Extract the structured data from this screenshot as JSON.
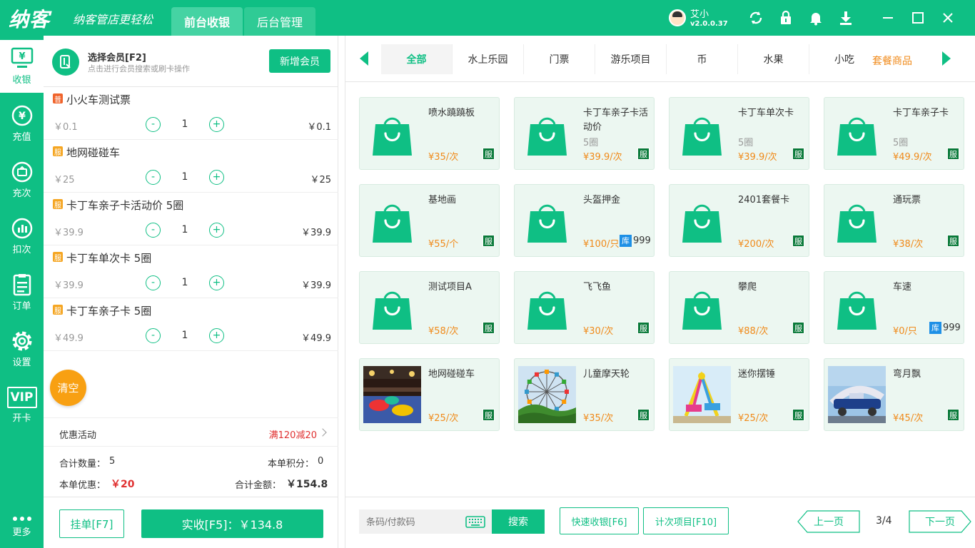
{
  "header": {
    "logo": "纳客",
    "slogan": "纳客管店更轻松",
    "tabs": [
      {
        "label": "前台收银"
      },
      {
        "label": "后台管理"
      }
    ],
    "user": {
      "name": "艾小",
      "version": "v2.0.0.37"
    }
  },
  "sidebar": {
    "items": [
      {
        "label": "收银",
        "icon": "cashier-icon"
      },
      {
        "label": "充值",
        "icon": "recharge-icon"
      },
      {
        "label": "充次",
        "icon": "recharge-times-icon"
      },
      {
        "label": "扣次",
        "icon": "deduct-icon"
      },
      {
        "label": "订单",
        "icon": "order-icon"
      },
      {
        "label": "设置",
        "icon": "settings-icon"
      },
      {
        "label": "开卡",
        "icon": "vip-card-icon"
      },
      {
        "label": "更多",
        "icon": "more-icon"
      }
    ],
    "vip_text": "VIP"
  },
  "member": {
    "title": "选择会员[F2]",
    "subtitle": "点击进行会员搜索或刷卡操作",
    "new_button": "新增会员"
  },
  "cart": {
    "items": [
      {
        "badge": "普",
        "name": "小火车测试票",
        "price": "￥0.1",
        "qty": "1",
        "total": "￥0.1"
      },
      {
        "badge": "服",
        "name": "地网碰碰车",
        "price": "￥25",
        "qty": "1",
        "total": "￥25"
      },
      {
        "badge": "服",
        "name": "卡丁车亲子卡活动价 5圈",
        "price": "￥39.9",
        "qty": "1",
        "total": "￥39.9"
      },
      {
        "badge": "服",
        "name": "卡丁车单次卡 5圈",
        "price": "￥39.9",
        "qty": "1",
        "total": "￥39.9"
      },
      {
        "badge": "服",
        "name": "卡丁车亲子卡 5圈",
        "price": "￥49.9",
        "qty": "1",
        "total": "￥49.9"
      }
    ],
    "minus": "-",
    "plus": "+",
    "clear_button": "清空"
  },
  "promotion": {
    "label": "优惠活动",
    "value": "满120减20"
  },
  "summary": {
    "count_label": "合计数量：",
    "count_value": "5",
    "points_label": "本单积分：",
    "points_value": "0",
    "discount_label": "本单优惠：",
    "discount_value": "￥20",
    "amount_label": "合计金额：",
    "amount_value": "￥154.8"
  },
  "actions": {
    "hang_button": "挂单[F7]",
    "pay_button": "实收[F5]：￥134.8"
  },
  "categories": {
    "items": [
      "全部",
      "水上乐园",
      "门票",
      "游乐项目",
      "币",
      "水果",
      "小吃"
    ],
    "extra": "套餐商品"
  },
  "products": [
    {
      "name": "喷水蹺蹺板",
      "sub": "",
      "price": "¥35/次",
      "tag": "服",
      "stock": "",
      "img": "bag"
    },
    {
      "name": "卡丁车亲子卡活动价",
      "sub": "5圈",
      "price": "¥39.9/次",
      "tag": "服",
      "stock": "",
      "img": "bag"
    },
    {
      "name": "卡丁车单次卡",
      "sub": "5圈",
      "price": "¥39.9/次",
      "tag": "服",
      "stock": "",
      "img": "bag"
    },
    {
      "name": "卡丁车亲子卡",
      "sub": "5圈",
      "price": "¥49.9/次",
      "tag": "服",
      "stock": "",
      "img": "bag"
    },
    {
      "name": "基地画",
      "sub": "",
      "price": "¥55/个",
      "tag": "服",
      "stock": "",
      "img": "bag"
    },
    {
      "name": "头盔押金",
      "sub": "",
      "price": "¥100/只",
      "tag": "",
      "stock": "999",
      "img": "bag"
    },
    {
      "name": "2401套餐卡",
      "sub": "",
      "price": "¥200/次",
      "tag": "服",
      "stock": "",
      "img": "bag"
    },
    {
      "name": "通玩票",
      "sub": "",
      "price": "¥38/次",
      "tag": "服",
      "stock": "",
      "img": "bag"
    },
    {
      "name": "测试项目A",
      "sub": "",
      "price": "¥58/次",
      "tag": "服",
      "stock": "",
      "img": "bag"
    },
    {
      "name": "飞飞鱼",
      "sub": "",
      "price": "¥30/次",
      "tag": "服",
      "stock": "",
      "img": "bag"
    },
    {
      "name": "攀爬",
      "sub": "",
      "price": "¥88/次",
      "tag": "服",
      "stock": "",
      "img": "bag"
    },
    {
      "name": "车速",
      "sub": "",
      "price": "¥0/只",
      "tag": "",
      "stock": "999",
      "img": "bag"
    },
    {
      "name": "地网碰碰车",
      "sub": "",
      "price": "¥25/次",
      "tag": "服",
      "stock": "",
      "img": "bumper"
    },
    {
      "name": "儿童摩天轮",
      "sub": "",
      "price": "¥35/次",
      "tag": "服",
      "stock": "",
      "img": "ferris"
    },
    {
      "name": "迷你摆锤",
      "sub": "",
      "price": "¥25/次",
      "tag": "服",
      "stock": "",
      "img": "pendulum"
    },
    {
      "name": "弯月飘",
      "sub": "",
      "price": "¥45/次",
      "tag": "服",
      "stock": "",
      "img": "moon"
    }
  ],
  "stock_badge": "库",
  "bottom": {
    "barcode_placeholder": "条码/付款码",
    "search_button": "搜索",
    "quick_button": "快速收银[F6]",
    "count_button": "计次项目[F10]",
    "prev_button": "上一页",
    "next_button": "下一页",
    "page_info": "3/4"
  },
  "colors": {
    "brand": "#0fbf84",
    "price": "#f08a1a",
    "discount": "#e03030",
    "service_tag": "#0a7a3a",
    "stock_tag": "#1e90e6"
  }
}
